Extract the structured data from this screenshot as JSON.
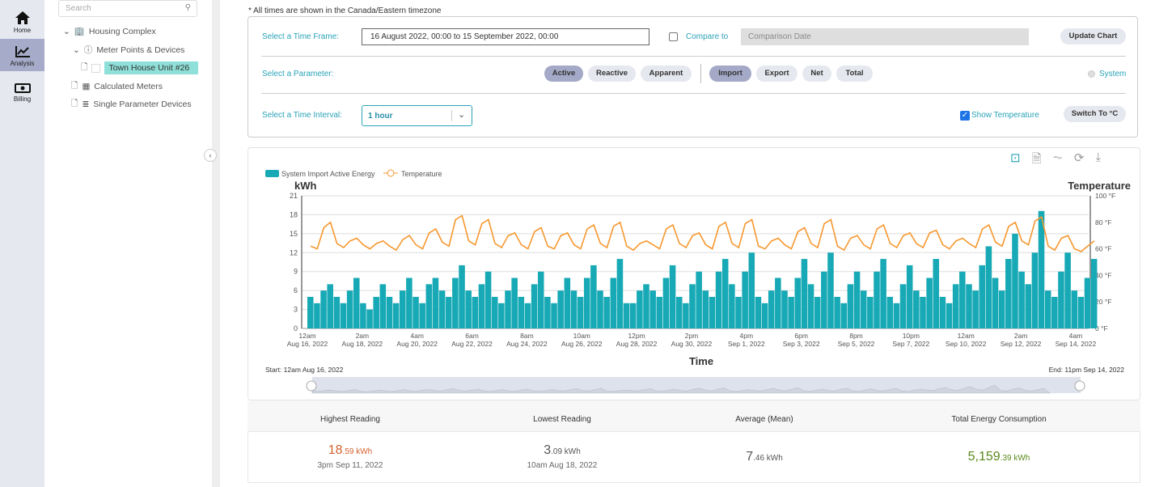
{
  "nav": {
    "items": [
      {
        "label": "Home",
        "icon": "home-icon"
      },
      {
        "label": "Analysis",
        "icon": "chart-icon",
        "active": true
      },
      {
        "label": "Billing",
        "icon": "billing-icon"
      }
    ]
  },
  "tree": {
    "search_placeholder": "Search",
    "root": "Housing Complex",
    "group": "Meter Points & Devices",
    "selected": "Town House Unit #26",
    "calc": "Calculated Meters",
    "single": "Single Parameter Devices"
  },
  "controls": {
    "timezone_note": "* All times are shown in the Canada/Eastern timezone",
    "time_frame_label": "Select a Time Frame:",
    "time_frame_value": "16 August 2022, 00:00  to  15 September 2022, 00:00",
    "compare_label": "Compare to",
    "compare_placeholder": "Comparison Date",
    "update_button": "Update Chart",
    "parameter_label": "Select a Parameter:",
    "param_types": [
      "Active",
      "Reactive",
      "Apparent"
    ],
    "param_directions": [
      "Import",
      "Export",
      "Net",
      "Total"
    ],
    "system_label": "System",
    "interval_label": "Select a Time Interval:",
    "interval_value": "1 hour",
    "show_temp_label": "Show Temperature",
    "show_temp_checked": true,
    "switch_button": "Switch To °C"
  },
  "colors": {
    "accent": "#2aa3b8",
    "bars": "#17a9b5",
    "temperature": "#f7972e",
    "highest": "#d2622e",
    "total": "#5a8a1e"
  },
  "chart_data": {
    "type": "bar+line",
    "legend": [
      "System Import Active Energy",
      "Temperature"
    ],
    "ylabel": "kWh",
    "y2label": "Temperature",
    "xlabel": "Time",
    "ylim": [
      0,
      21
    ],
    "yticks": [
      0,
      3,
      6,
      9,
      12,
      15,
      18,
      21
    ],
    "y2lim": [
      0,
      100
    ],
    "y2ticks": [
      "0 °F",
      "20 °F",
      "40 °F",
      "60 °F",
      "80 °F",
      "100 °F"
    ],
    "xticks": [
      [
        "12am",
        "Aug 16, 2022"
      ],
      [
        "2am",
        "Aug 18, 2022"
      ],
      [
        "4am",
        "Aug 20, 2022"
      ],
      [
        "6am",
        "Aug 22, 2022"
      ],
      [
        "8am",
        "Aug 24, 2022"
      ],
      [
        "10am",
        "Aug 26, 2022"
      ],
      [
        "12pm",
        "Aug 28, 2022"
      ],
      [
        "2pm",
        "Aug 30, 2022"
      ],
      [
        "4pm",
        "Sep 1, 2022"
      ],
      [
        "6pm",
        "Sep 3, 2022"
      ],
      [
        "8pm",
        "Sep 5, 2022"
      ],
      [
        "10pm",
        "Sep 7, 2022"
      ],
      [
        "12am",
        "Sep 10, 2022"
      ],
      [
        "2am",
        "Sep 12, 2022"
      ],
      [
        "4am",
        "Sep 14, 2022"
      ]
    ],
    "x_resolution": "6 hours, starting 12am Aug 16, 2022",
    "energy_kwh": [
      5,
      4,
      6,
      7,
      5,
      4,
      6,
      8,
      4,
      3,
      5,
      7,
      5,
      4,
      6,
      8,
      5,
      4,
      7,
      8,
      6,
      5,
      8,
      10,
      6,
      5,
      7,
      9,
      5,
      4,
      6,
      8,
      5,
      4,
      7,
      9,
      5,
      4,
      6,
      8,
      6,
      5,
      8,
      10,
      6,
      5,
      8,
      11,
      4,
      4,
      6,
      7,
      6,
      5,
      8,
      10,
      5,
      4,
      7,
      9,
      6,
      5,
      9,
      11,
      7,
      5,
      9,
      12,
      5,
      4,
      6,
      8,
      6,
      5,
      8,
      11,
      7,
      5,
      9,
      12,
      5,
      4,
      7,
      9,
      6,
      5,
      9,
      11,
      5,
      4,
      7,
      10,
      6,
      5,
      8,
      11,
      5,
      4,
      7,
      9,
      7,
      6,
      10,
      13,
      8,
      6,
      11,
      15,
      9,
      7,
      12,
      18.59,
      6,
      5,
      9,
      12,
      6,
      5,
      8,
      11
    ],
    "temperature_f": [
      62,
      60,
      76,
      80,
      64,
      61,
      66,
      68,
      63,
      60,
      64,
      66,
      62,
      59,
      67,
      70,
      63,
      60,
      72,
      75,
      65,
      62,
      82,
      85,
      66,
      63,
      79,
      82,
      64,
      61,
      70,
      72,
      63,
      60,
      73,
      76,
      62,
      60,
      70,
      72,
      63,
      60,
      75,
      78,
      64,
      61,
      77,
      80,
      62,
      59,
      64,
      66,
      63,
      60,
      75,
      78,
      64,
      61,
      70,
      72,
      63,
      60,
      77,
      80,
      64,
      61,
      79,
      82,
      62,
      60,
      66,
      68,
      63,
      60,
      73,
      76,
      64,
      61,
      79,
      82,
      62,
      59,
      68,
      70,
      63,
      60,
      75,
      78,
      64,
      61,
      70,
      72,
      64,
      61,
      72,
      74,
      63,
      60,
      66,
      68,
      64,
      61,
      75,
      78,
      65,
      62,
      77,
      80,
      66,
      63,
      81,
      84,
      62,
      59,
      68,
      70,
      60,
      58,
      62,
      66
    ],
    "navigator": {
      "start": "Start: 12am Aug 16, 2022",
      "end": "End: 11pm Sep 14, 2022"
    }
  },
  "stats": [
    {
      "title": "Highest Reading",
      "int": "18",
      "dec": ".59",
      "unit": " kWh",
      "sub": "3pm Sep 11, 2022"
    },
    {
      "title": "Lowest Reading",
      "int": "3",
      "dec": ".09",
      "unit": " kWh",
      "sub": "10am Aug 18, 2022"
    },
    {
      "title": "Average (Mean)",
      "int": "7",
      "dec": ".46",
      "unit": " kWh",
      "sub": ""
    },
    {
      "title": "Total Energy Consumption",
      "int": "5,159",
      "dec": ".39",
      "unit": " kWh",
      "sub": ""
    }
  ]
}
